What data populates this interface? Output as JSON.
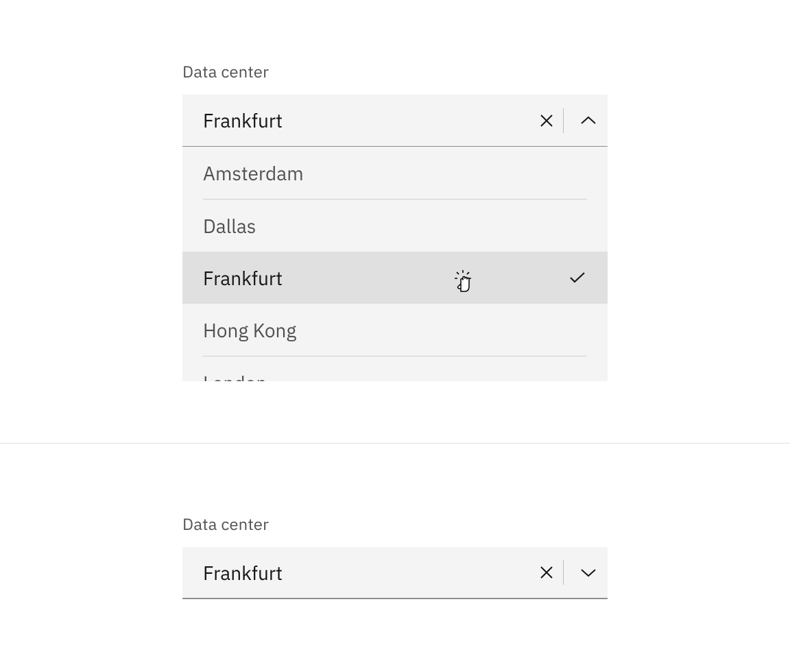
{
  "dropdown_open": {
    "label": "Data center",
    "value": "Frankfurt",
    "options": [
      "Amsterdam",
      "Dallas",
      "Frankfurt",
      "Hong Kong",
      "London"
    ],
    "selected_index": 2
  },
  "dropdown_closed": {
    "label": "Data center",
    "value": "Frankfurt"
  }
}
